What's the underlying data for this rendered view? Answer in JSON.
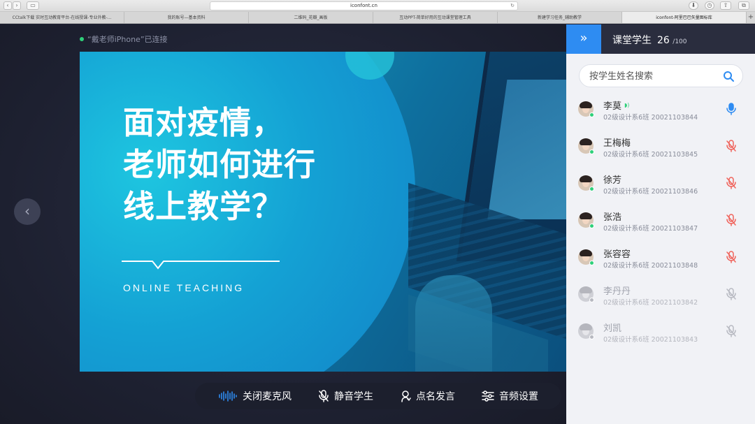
{
  "browser": {
    "url": "iconfont.cn",
    "tabs": [
      {
        "label": "CCtalk下载 实时互动教育平台-在线授课-专业外教-...",
        "active": false
      },
      {
        "label": "我的账号—基本资料",
        "active": false
      },
      {
        "label": "二维码_花瓣_画板",
        "active": false
      },
      {
        "label": "互动PPT-简单好用的互动课堂管理工具",
        "active": false
      },
      {
        "label": "新建学习任务_辅助教学",
        "active": false
      },
      {
        "label": "iconfont-阿里巴巴矢量图标库",
        "active": true
      }
    ]
  },
  "stage": {
    "connection_status": "“戴老师iPhone”已连接",
    "slide": {
      "title_lines": [
        "面对疫情，",
        "老师如何进行",
        "线上教学？"
      ],
      "subtitle": "ONLINE TEACHING"
    },
    "controls": [
      {
        "icon": "sound-wave-icon",
        "label": "关闭麦克风"
      },
      {
        "icon": "mic-mute-icon",
        "label": "静音学生"
      },
      {
        "icon": "hand-icon",
        "label": "点名发言"
      },
      {
        "icon": "sliders-icon",
        "label": "音频设置"
      }
    ]
  },
  "sidebar": {
    "collapse_icon": "double-chevron-right-icon",
    "title": "课堂学生",
    "count": "26",
    "total": "/100",
    "search_placeholder": "按学生姓名搜索",
    "students": [
      {
        "name": "李莫",
        "info": "02级设计系6班  20021103844",
        "online": true,
        "mic": "on",
        "speaking": true
      },
      {
        "name": "王梅梅",
        "info": "02级设计系6班  20021103845",
        "online": true,
        "mic": "muted",
        "speaking": false
      },
      {
        "name": "徐芳",
        "info": "02级设计系6班  20021103846",
        "online": true,
        "mic": "muted",
        "speaking": false
      },
      {
        "name": "张浩",
        "info": "02级设计系6班  20021103847",
        "online": true,
        "mic": "muted",
        "speaking": false
      },
      {
        "name": "张容容",
        "info": "02级设计系6班  20021103848",
        "online": true,
        "mic": "muted",
        "speaking": false
      },
      {
        "name": "李丹丹",
        "info": "02级设计系6班  20021103842",
        "online": false,
        "mic": "disabled",
        "speaking": false
      },
      {
        "name": "刘凯",
        "info": "02级设计系6班  20021103843",
        "online": false,
        "mic": "disabled",
        "speaking": false
      }
    ],
    "colors": {
      "mic_on": "#2e8cf2",
      "mic_muted": "#f0625a",
      "mic_disabled": "#b7b9c1",
      "online": "#2fd07a"
    }
  }
}
